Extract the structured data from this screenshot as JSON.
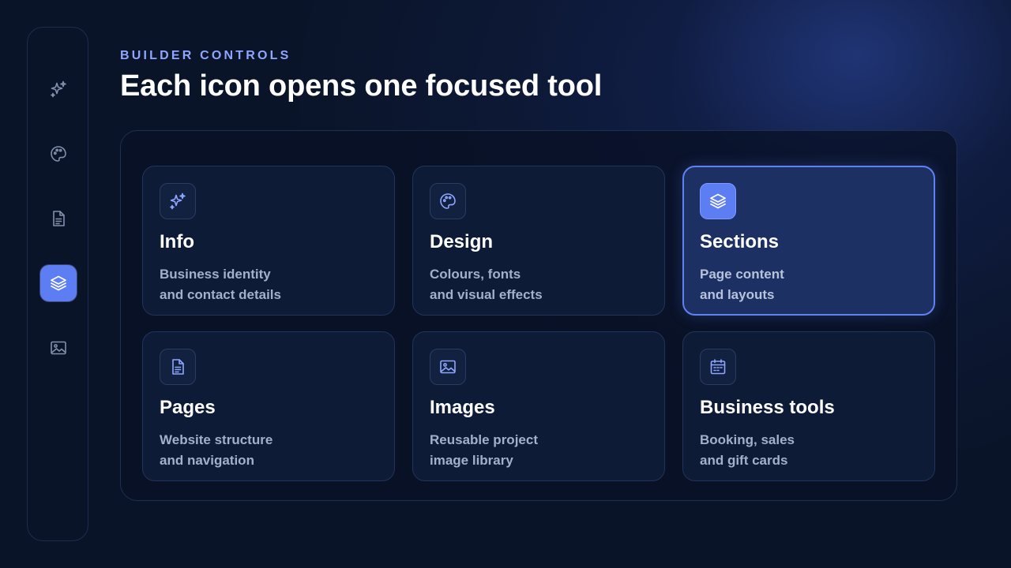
{
  "header": {
    "eyebrow": "BUILDER CONTROLS",
    "title": "Each icon opens one focused tool"
  },
  "rail": {
    "items": [
      {
        "icon": "sparkle-icon",
        "active": false
      },
      {
        "icon": "palette-icon",
        "active": false
      },
      {
        "icon": "document-icon",
        "active": false
      },
      {
        "icon": "layers-icon",
        "active": true
      },
      {
        "icon": "image-icon",
        "active": false
      }
    ]
  },
  "cards": [
    {
      "icon": "sparkle-icon",
      "title": "Info",
      "desc_line1": "Business identity",
      "desc_line2": "and contact details",
      "active": false
    },
    {
      "icon": "palette-icon",
      "title": "Design",
      "desc_line1": "Colours, fonts",
      "desc_line2": "and visual effects",
      "active": false
    },
    {
      "icon": "layers-icon",
      "title": "Sections",
      "desc_line1": "Page content",
      "desc_line2": "and layouts",
      "active": true
    },
    {
      "icon": "document-icon",
      "title": "Pages",
      "desc_line1": "Website structure",
      "desc_line2": "and navigation",
      "active": false
    },
    {
      "icon": "image-icon",
      "title": "Images",
      "desc_line1": "Reusable project",
      "desc_line2": "image library",
      "active": false
    },
    {
      "icon": "calendar-icon",
      "title": "Business tools",
      "desc_line1": "Booking, sales",
      "desc_line2": "and gift cards",
      "active": false
    }
  ],
  "colors": {
    "accent": "#5d7df3",
    "eyebrow": "#8ea6ff",
    "background": "#0a1429",
    "card": "#0e1b36",
    "card_active": "#1c3064"
  }
}
